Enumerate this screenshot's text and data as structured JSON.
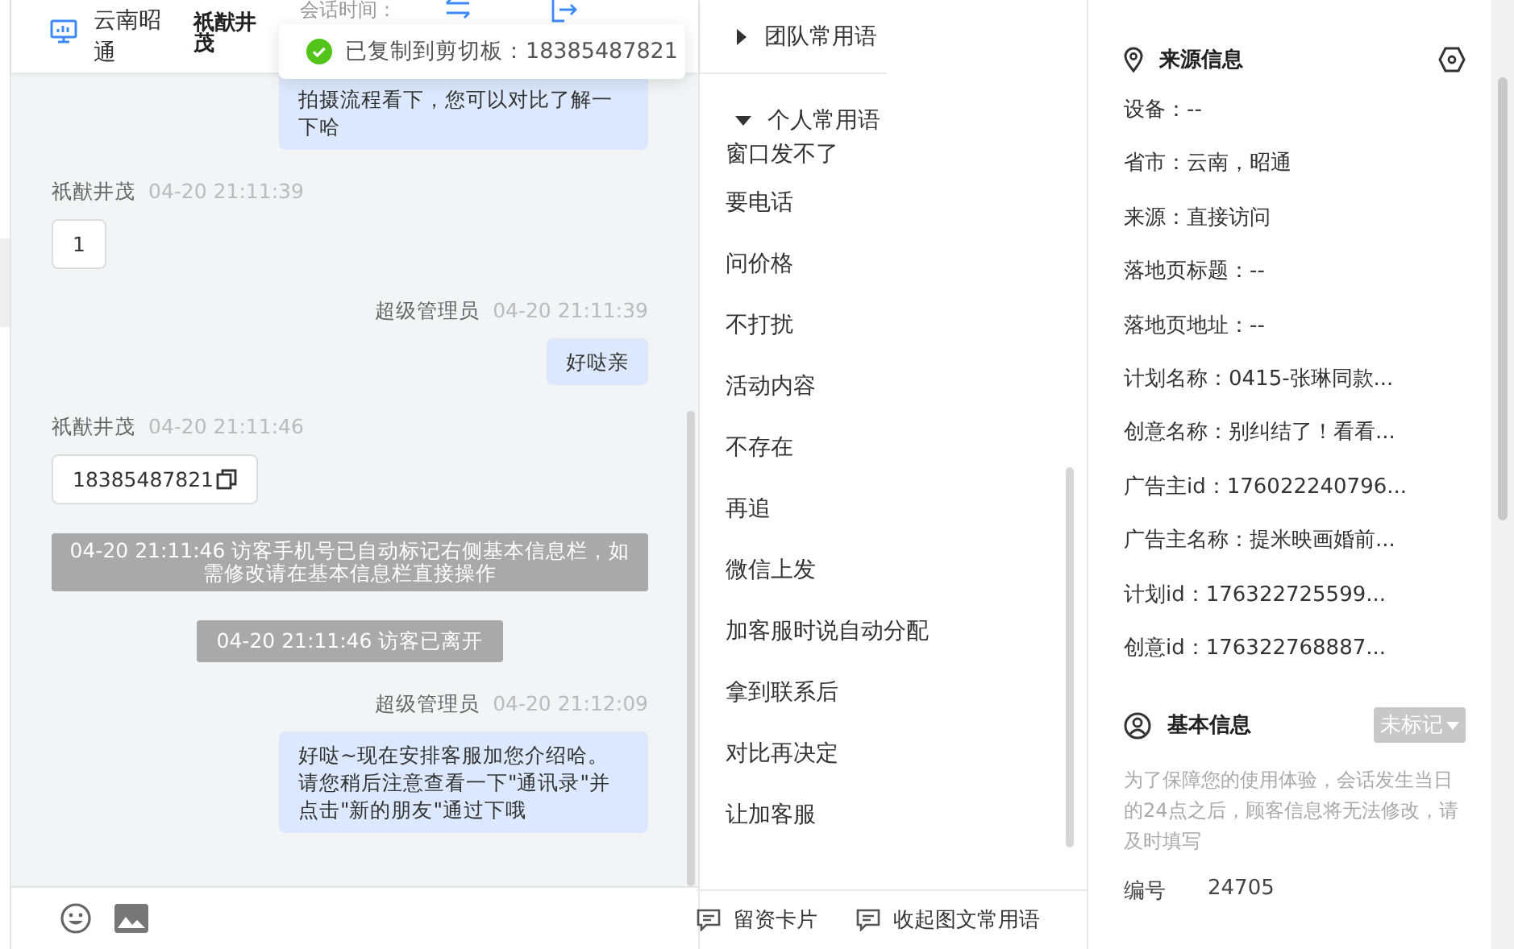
{
  "header": {
    "location": "云南昭通",
    "visitor": "祇猷井茂",
    "session_time_label": "会话时间："
  },
  "toast": {
    "text": "已复制到剪切板：18385487821"
  },
  "messages": [
    {
      "kind": "agent",
      "text": "拍摄流程看下，您可以对比了解一下哈"
    },
    {
      "kind": "visitor",
      "sender": "祇猷井茂",
      "time": "04-20 21:11:39",
      "text": "1",
      "copyable": false
    },
    {
      "kind": "agent",
      "sender": "超级管理员",
      "time": "04-20 21:11:39",
      "text": "好哒亲"
    },
    {
      "kind": "visitor",
      "sender": "祇猷井茂",
      "time": "04-20 21:11:46",
      "text": "18385487821",
      "copyable": true
    },
    {
      "kind": "system",
      "text": "04-20 21:11:46 访客手机号已自动标记右侧基本信息栏，如需修改请在基本信息栏直接操作"
    },
    {
      "kind": "system",
      "text": "04-20 21:11:46 访客已离开"
    },
    {
      "kind": "agent",
      "sender": "超级管理员",
      "time": "04-20 21:12:09",
      "text": "好哒~现在安排客服加您介绍哈。请您稍后注意查看一下\"通讯录\"并点击\"新的朋友\"通过下哦"
    }
  ],
  "phrases": [
    {
      "label": "团队常用语",
      "expanded": false
    },
    {
      "label": "个人常用语",
      "expanded": true,
      "items": [
        "窗口发不了",
        "要电话",
        "问价格",
        "不打扰",
        "活动内容",
        "不存在",
        "再追",
        "微信上发",
        "加客服时说自动分配",
        "拿到联系后",
        "对比再决定",
        "让加客服"
      ]
    }
  ],
  "toolbar": [
    "留资卡片",
    "收起图文常用语"
  ],
  "source": {
    "title": "来源信息",
    "fields": [
      "设备：--",
      "省市：云南，昭通",
      "来源：直接访问",
      "落地页标题：--",
      "落地页地址：--",
      "计划名称：0415-张琳同款...",
      "创意名称：别纠结了！看看...",
      "广告主id：176022240796...",
      "广告主名称：提米映画婚前...",
      "计划id：176322725599...",
      "创意id：176322768887..."
    ]
  },
  "basic": {
    "title": "基本信息",
    "tag": "未标记",
    "notice": "为了保障您的使用体验，会话发生当日的24点之后，顾客信息将无法修改，请及时填写",
    "fields": [
      {
        "label": "编号",
        "value": "24705"
      }
    ]
  }
}
